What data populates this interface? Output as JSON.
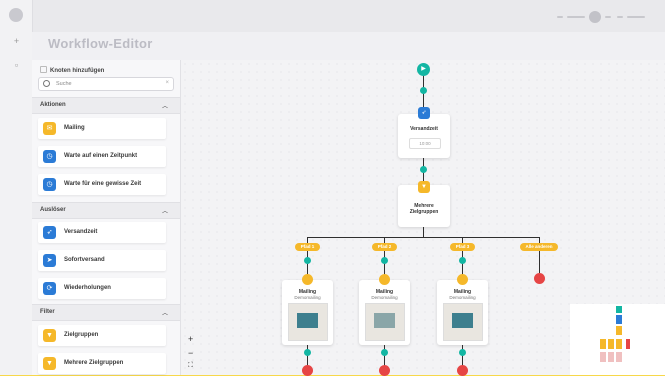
{
  "app": {
    "title": "Workflow-Editor"
  },
  "panel": {
    "heading": "Knoten hinzufügen",
    "search_placeholder": "Suche",
    "sections": [
      {
        "label": "Aktionen",
        "items": [
          {
            "label": "Mailing",
            "icon": "mail-icon",
            "color": "#f5b82a"
          },
          {
            "label": "Warte auf einen Zeitpunkt",
            "icon": "clock-icon",
            "color": "#2b7bd6"
          },
          {
            "label": "Warte für eine gewisse Zeit",
            "icon": "timer-icon",
            "color": "#2b7bd6"
          }
        ]
      },
      {
        "label": "Auslöser",
        "items": [
          {
            "label": "Versandzeit",
            "icon": "send-time-icon",
            "color": "#2b7bd6"
          },
          {
            "label": "Sofortversand",
            "icon": "paper-plane-icon",
            "color": "#2b7bd6"
          },
          {
            "label": "Wiederholungen",
            "icon": "repeat-icon",
            "color": "#2b7bd6"
          }
        ]
      },
      {
        "label": "Filter",
        "items": [
          {
            "label": "Zielgruppen",
            "icon": "filter-icon",
            "color": "#f5b82a"
          },
          {
            "label": "Mehrere Zielgruppen",
            "icon": "filter-multi-icon",
            "color": "#f5b82a"
          }
        ]
      }
    ]
  },
  "workflow": {
    "trigger": {
      "title": "Versandzeit",
      "time": "10:00"
    },
    "filter": {
      "title": "Mehrere Zielgruppen"
    },
    "branches": [
      "Pfad 1",
      "Pfad 2",
      "Pfad 3",
      "Alle anderen"
    ],
    "mailings": [
      {
        "title": "Mailing",
        "subtitle": "Demomailing"
      },
      {
        "title": "Mailing",
        "subtitle": "Demomailing"
      },
      {
        "title": "Mailing",
        "subtitle": "Demomailing"
      }
    ]
  },
  "zoom": {
    "in": "+",
    "out": "−",
    "fit": "⛶"
  },
  "colors": {
    "accent": "#f5b82a",
    "teal": "#13b6a3",
    "blue": "#2b7bd6",
    "stop": "#e64545",
    "brand_bg": "#f7d84a"
  }
}
